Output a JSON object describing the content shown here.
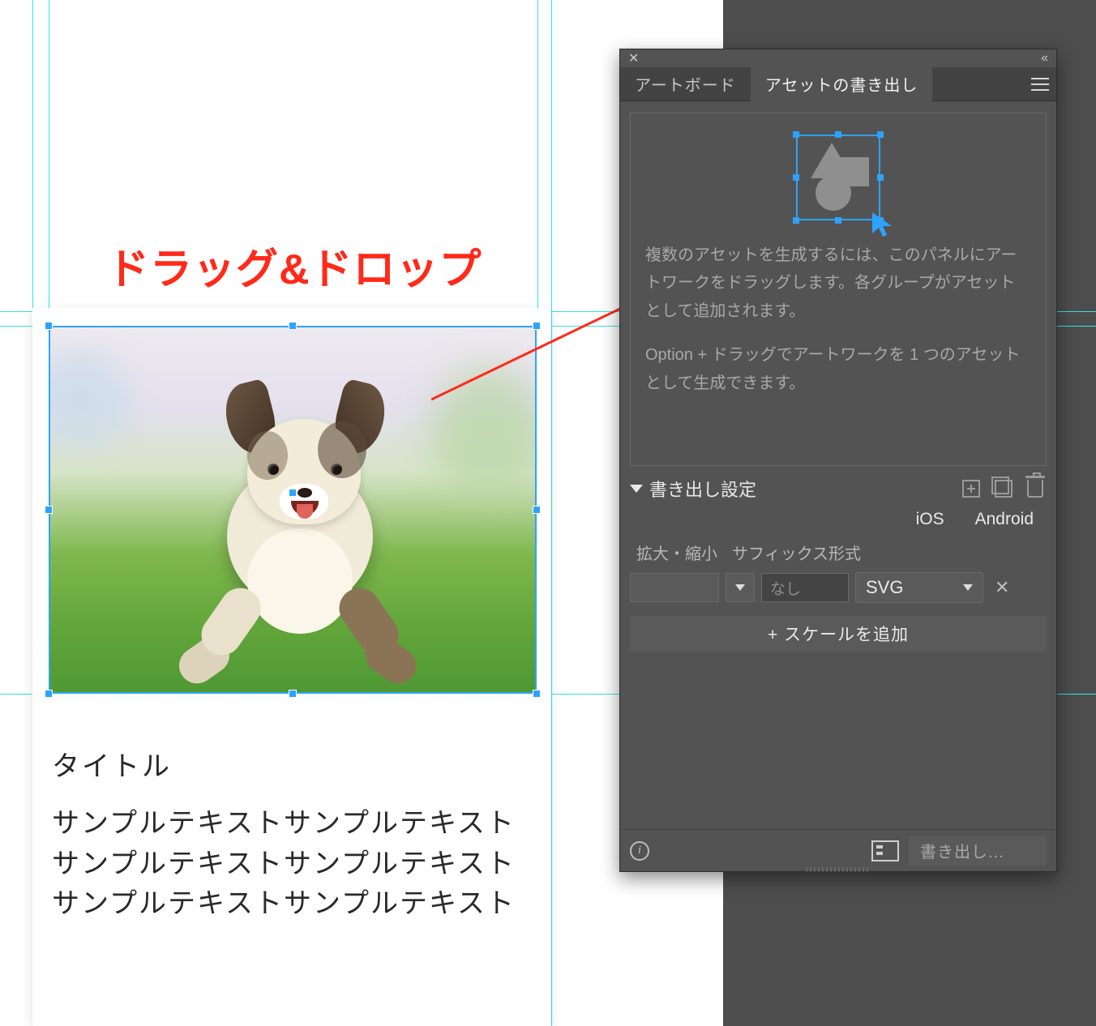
{
  "annotation": {
    "text": "ドラッグ&ドロップ"
  },
  "card": {
    "title": "タイトル",
    "body": "サンプルテキストサンプルテキストサンプルテキストサンプルテキストサンプルテキストサンプルテキスト"
  },
  "panel": {
    "tabs": {
      "artboards": "アートボード",
      "asset_export": "アセットの書き出し"
    },
    "dropzone": {
      "message1": "複数のアセットを生成するには、このパネルにアートワークをドラッグします。各グループがアセットとして追加されます。",
      "message2": "Option + ドラッグでアートワークを 1 つのアセットとして生成できます。"
    },
    "settings": {
      "section_label": "書き出し設定",
      "platform_ios": "iOS",
      "platform_android": "Android",
      "header_scale": "拡大・縮小",
      "header_suffix": "サフィックス形式",
      "suffix_placeholder": "なし",
      "format_selected": "SVG",
      "add_scale": "+  スケールを追加"
    },
    "footer": {
      "export_label": "書き出し..."
    }
  },
  "colors": {
    "annotation": "#ff2a1a",
    "selection": "#2da3ff",
    "guide": "#34e3ec"
  }
}
